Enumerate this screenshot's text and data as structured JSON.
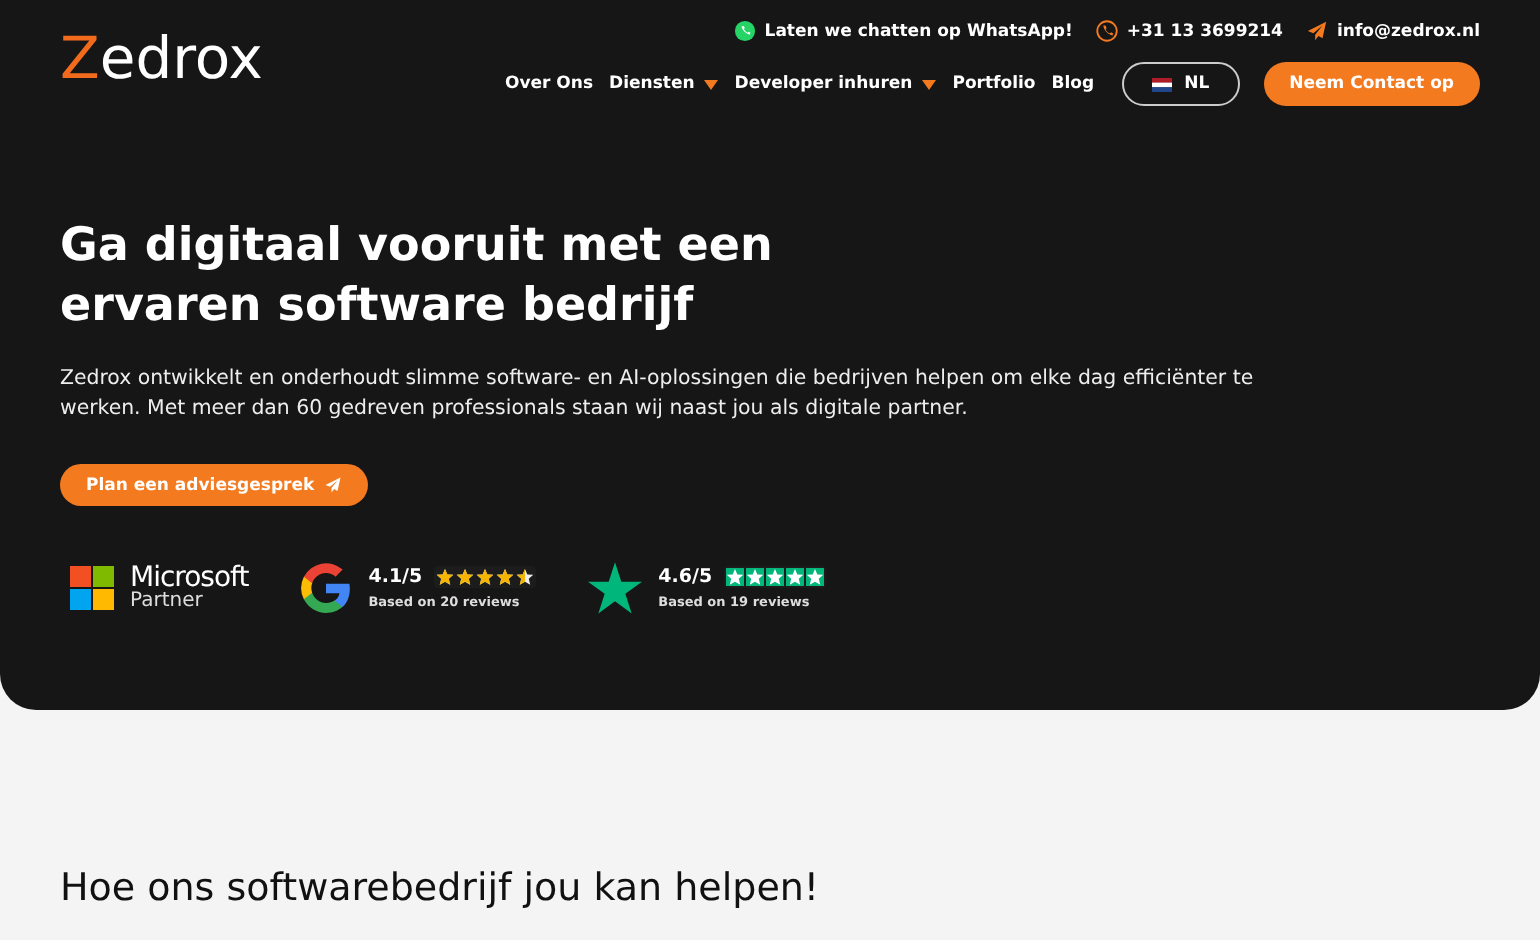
{
  "header": {
    "logo_first": "Z",
    "logo_rest": "edrox",
    "contacts": [
      {
        "kind": "whatsapp",
        "text": "Laten we chatten op WhatsApp!"
      },
      {
        "kind": "phone",
        "text": "+31 13 3699214"
      },
      {
        "kind": "mail",
        "text": "info@zedrox.nl"
      }
    ],
    "nav": [
      {
        "label": "Over Ons",
        "dropdown": false
      },
      {
        "label": "Diensten",
        "dropdown": true
      },
      {
        "label": "Developer inhuren",
        "dropdown": true
      },
      {
        "label": "Portfolio",
        "dropdown": false
      },
      {
        "label": "Blog",
        "dropdown": false
      }
    ],
    "language": "NL",
    "cta": "Neem Contact op"
  },
  "hero": {
    "title": "Ga digitaal vooruit met een ervaren software bedrijf",
    "text": "Zedrox ontwikkelt en onderhoudt slimme software- en AI-oplossingen die bedrijven helpen om elke dag efficiënter te werken. Met meer dan 60 gedreven professionals staan wij naast jou als digitale partner.",
    "button": "Plan een adviesgesprek",
    "badges": [
      {
        "kind": "microsoft",
        "line1": "Microsoft",
        "line2": "Partner"
      },
      {
        "kind": "google",
        "score": "4.1/5",
        "stars": 4.5,
        "color": "#f5b400",
        "note": "Based on 20 reviews"
      },
      {
        "kind": "trustpilot",
        "score": "4.6/5",
        "stars": 5,
        "color": "#00b67a",
        "note": "Based on 19 reviews"
      }
    ]
  },
  "section": {
    "title": "Hoe ons softwarebedrijf jou kan helpen!"
  }
}
